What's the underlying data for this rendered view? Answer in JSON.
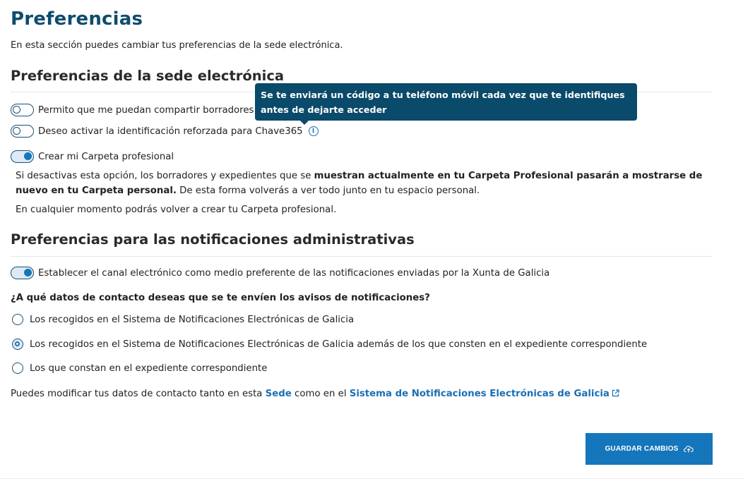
{
  "page": {
    "title": "Preferencias",
    "intro": "En esta sección puedes cambiar tus preferencias de la sede electrónica."
  },
  "sede": {
    "heading": "Preferencias de la sede electrónica",
    "toggles": [
      {
        "label": "Permito que me puedan compartir borradores",
        "on": false
      },
      {
        "label": "Deseo activar la identificación reforzada para Chave365",
        "on": false
      },
      {
        "label": "Crear mi Carpeta profesional",
        "on": true
      }
    ],
    "tooltip": "Se te enviará un código a tu teléfono móvil cada vez que te identifiques antes de dejarte acceder",
    "info_icon": "info-circle-icon",
    "carpeta_note": {
      "part1": "Si desactivas esta opción, los borradores y expedientes que se ",
      "bold1": "muestran actualmente en tu Carpeta Profesional pasarán a mostrarse de nuevo en tu Carpeta personal.",
      "part2": " De esta forma volverás a ver todo junto en tu espacio personal."
    },
    "carpeta_note2": "En cualquier momento podrás volver a crear tu Carpeta profesional."
  },
  "notificaciones": {
    "heading": "Preferencias para las notificaciones administrativas",
    "toggle": {
      "label": "Establecer el canal electrónico como medio preferente de las notificaciones enviadas por la Xunta de Galicia",
      "on": true
    },
    "question": "¿A qué datos de contacto deseas que se te envíen los avisos de notificaciones?",
    "options": [
      {
        "label": "Los recogidos en el Sistema de Notificaciones Electrónicas de Galicia",
        "checked": false
      },
      {
        "label": "Los recogidos en el Sistema de Notificaciones Electrónicas de Galicia además de los que consten en el expediente correspondiente",
        "checked": true
      },
      {
        "label": "Los que constan en el expediente correspondiente",
        "checked": false
      }
    ],
    "footer": {
      "part1": "Puedes modificar tus datos de contacto tanto en esta ",
      "link1": "Sede",
      "part2": " como en el ",
      "link2": "Sistema de Notificaciones Electrónicas de Galicia",
      "link2_icon": "external-link-icon"
    }
  },
  "actions": {
    "save_label": "GUARDAR CAMBIOS",
    "save_icon": "cloud-upload-icon"
  },
  "colors": {
    "title": "#0e4d6e",
    "accent": "#1576bb",
    "tooltip_bg": "#0a4a6a",
    "link": "#1a6fb5"
  }
}
